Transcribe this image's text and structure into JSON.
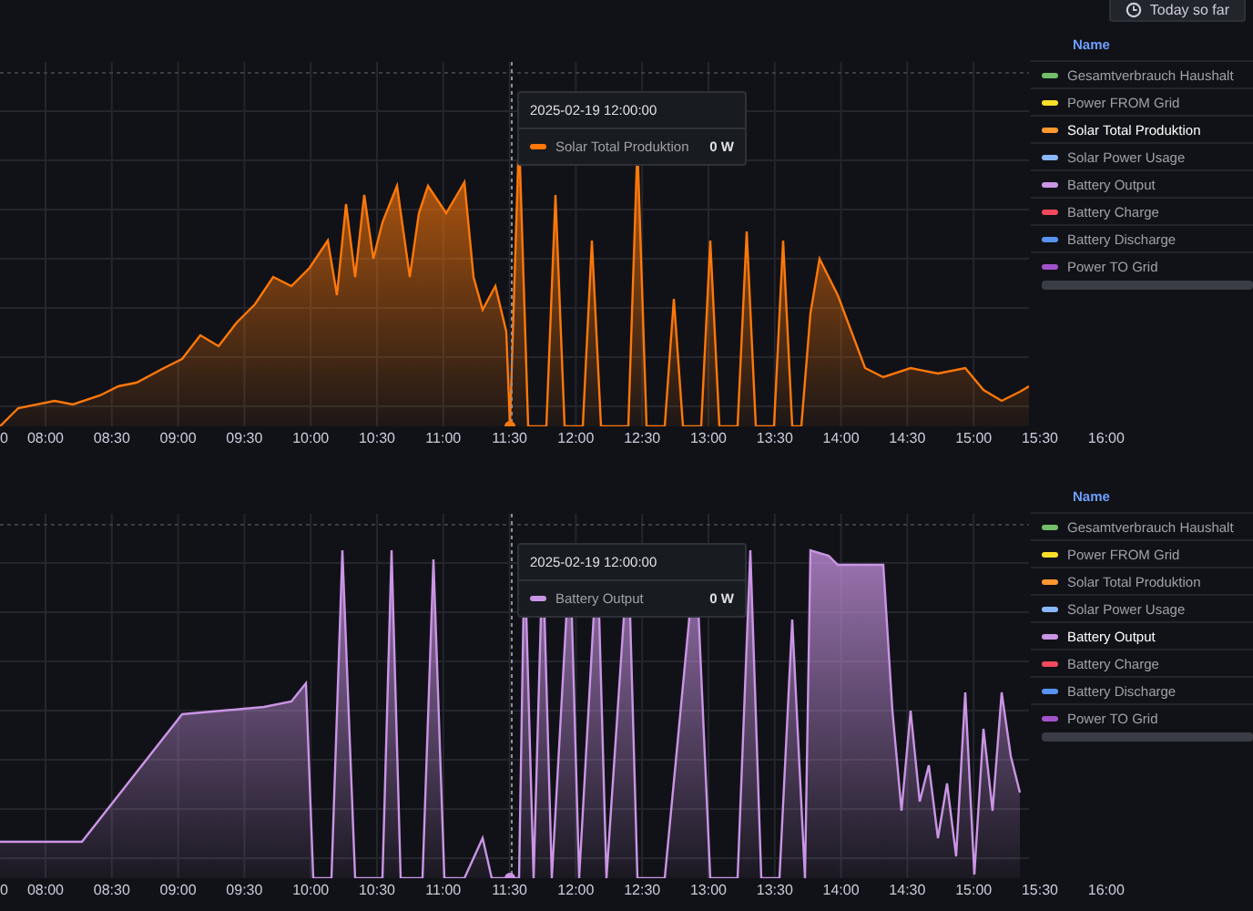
{
  "time_picker": {
    "label": "Today so far"
  },
  "panels": [
    {
      "tooltip": {
        "time": "2025-02-19 12:00:00",
        "series": "Solar Total Produktion",
        "value": "0 W",
        "color": "#ff780a"
      },
      "x_labels": [
        "0",
        "08:00",
        "08:30",
        "09:00",
        "09:30",
        "10:00",
        "10:30",
        "11:00",
        "11:30",
        "12:00",
        "12:30",
        "13:00",
        "13:30",
        "14:00",
        "14:30",
        "15:00",
        "15:30",
        "16:00"
      ],
      "legend": {
        "header": "Name",
        "items": [
          {
            "name": "Gesamtverbrauch Haushalt",
            "color": "#73bf69",
            "selected": false
          },
          {
            "name": "Power FROM Grid",
            "color": "#fade2a",
            "selected": false
          },
          {
            "name": "Solar Total Produktion",
            "color": "#ff9830",
            "selected": true
          },
          {
            "name": "Solar Power Usage",
            "color": "#8ab8ff",
            "selected": false
          },
          {
            "name": "Battery Output",
            "color": "#ca95e5",
            "selected": false
          },
          {
            "name": "Battery Charge",
            "color": "#f2495c",
            "selected": false
          },
          {
            "name": "Battery Discharge",
            "color": "#5794f2",
            "selected": false
          },
          {
            "name": "Power TO Grid",
            "color": "#a352cc",
            "selected": false
          }
        ]
      }
    },
    {
      "tooltip": {
        "time": "2025-02-19 12:00:00",
        "series": "Battery Output",
        "value": "0 W",
        "color": "#ca95e5"
      },
      "x_labels": [
        "0",
        "08:00",
        "08:30",
        "09:00",
        "09:30",
        "10:00",
        "10:30",
        "11:00",
        "11:30",
        "12:00",
        "12:30",
        "13:00",
        "13:30",
        "14:00",
        "14:30",
        "15:00",
        "15:30",
        "16:00"
      ],
      "legend": {
        "header": "Name",
        "items": [
          {
            "name": "Gesamtverbrauch Haushalt",
            "color": "#73bf69",
            "selected": false
          },
          {
            "name": "Power FROM Grid",
            "color": "#fade2a",
            "selected": false
          },
          {
            "name": "Solar Total Produktion",
            "color": "#ff9830",
            "selected": false
          },
          {
            "name": "Solar Power Usage",
            "color": "#8ab8ff",
            "selected": false
          },
          {
            "name": "Battery Output",
            "color": "#ca95e5",
            "selected": true
          },
          {
            "name": "Battery Charge",
            "color": "#f2495c",
            "selected": false
          },
          {
            "name": "Battery Discharge",
            "color": "#5794f2",
            "selected": false
          },
          {
            "name": "Power TO Grid",
            "color": "#a352cc",
            "selected": false
          }
        ]
      }
    }
  ]
}
